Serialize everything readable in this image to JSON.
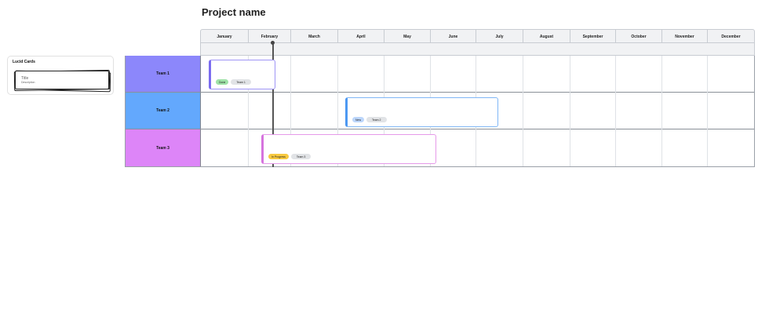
{
  "project": {
    "title": "Project name"
  },
  "panel": {
    "title": "Lucid Cards",
    "card": {
      "title": "Title",
      "description": "Description"
    }
  },
  "months": [
    "January",
    "February",
    "March",
    "April",
    "May",
    "June",
    "July",
    "August",
    "September",
    "October",
    "November",
    "December"
  ],
  "teams": [
    {
      "name": "Team 1",
      "color": "#8c87fb"
    },
    {
      "name": "Team 2",
      "color": "#63a8fd"
    },
    {
      "name": "Team 3",
      "color": "#dd85f8"
    }
  ],
  "tasks": [
    {
      "status": "Done",
      "team": "Team 1",
      "status_color": "#9fe3a8",
      "accent": "#7b6cf0"
    },
    {
      "status": "New",
      "team": "Team 2",
      "status_color": "#bcd6fb",
      "accent": "#4d98f2"
    },
    {
      "status": "In Progress",
      "team": "Team 3",
      "status_color": "#f7c940",
      "accent": "#d673de"
    }
  ]
}
